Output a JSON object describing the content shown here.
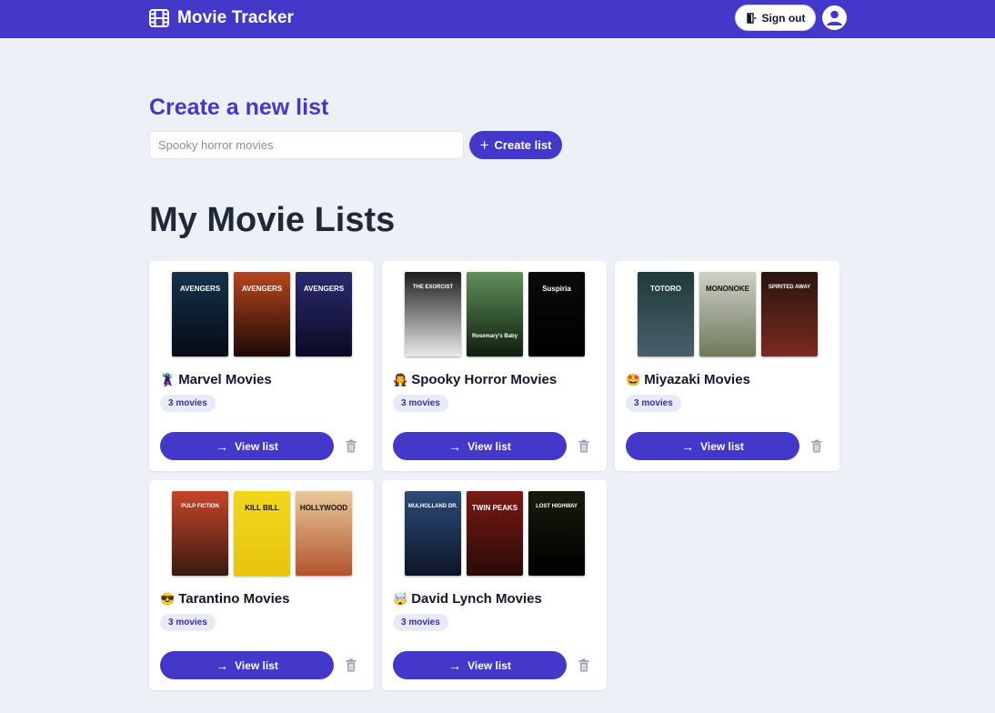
{
  "header": {
    "app_name": "Movie Tracker",
    "signout_label": "Sign out"
  },
  "create": {
    "title": "Create a new list",
    "input_value": "",
    "input_placeholder": "Spooky horror movies",
    "button_label": "Create list"
  },
  "lists_title": "My Movie Lists",
  "view_label": "View list",
  "lists": [
    {
      "emoji": "🦹",
      "name": "Marvel Movies",
      "count": "3 movies",
      "posters": [
        {
          "title": "AVENGERS",
          "colors": [
            "#16324a",
            "#050b14"
          ]
        },
        {
          "title": "AVENGERS",
          "colors": [
            "#b8451c",
            "#1d0a06"
          ]
        },
        {
          "title": "AVENGERS",
          "colors": [
            "#2b2a6f",
            "#0a0a24"
          ]
        }
      ]
    },
    {
      "emoji": "🧛",
      "name": "Spooky Horror Movies",
      "count": "3 movies",
      "posters": [
        {
          "title": "THE EXORCIST",
          "colors": [
            "#1c1c1c",
            "#e9e9e9"
          ]
        },
        {
          "title": "Rosemary's Baby",
          "colors": [
            "#5f8f5a",
            "#0f1f0f"
          ]
        },
        {
          "title": "Suspiria",
          "colors": [
            "#0a0a0a",
            "#000000"
          ]
        }
      ]
    },
    {
      "emoji": "🤩",
      "name": "Miyazaki Movies",
      "count": "3 movies",
      "posters": [
        {
          "title": "TOTORO",
          "colors": [
            "#1f3a3a",
            "#4a5f6a"
          ]
        },
        {
          "title": "MONONOKE",
          "colors": [
            "#cfcfc7",
            "#6e7a5a"
          ]
        },
        {
          "title": "SPIRITED AWAY",
          "colors": [
            "#2a1410",
            "#7a2a1e"
          ]
        }
      ]
    },
    {
      "emoji": "😎",
      "name": "Tarantino Movies",
      "count": "3 movies",
      "posters": [
        {
          "title": "PULP FICTION",
          "colors": [
            "#c8442a",
            "#3a1a10"
          ]
        },
        {
          "title": "KILL BILL",
          "colors": [
            "#f2d71e",
            "#e6c50c"
          ]
        },
        {
          "title": "HOLLYWOOD",
          "colors": [
            "#e8c89a",
            "#b4542e"
          ]
        }
      ]
    },
    {
      "emoji": "🤯",
      "name": "David Lynch Movies",
      "count": "3 movies",
      "posters": [
        {
          "title": "MULHOLLAND DR.",
          "colors": [
            "#2c4a7a",
            "#0d1526"
          ]
        },
        {
          "title": "TWIN PEAKS",
          "colors": [
            "#7a1a14",
            "#2a0a08"
          ]
        },
        {
          "title": "LOST HIGHWAY",
          "colors": [
            "#1a1a10",
            "#000000"
          ]
        }
      ]
    }
  ],
  "colors": {
    "accent": "#4338ca",
    "background": "#edf0f6",
    "badge_bg": "#e8eaf6"
  },
  "icons": {
    "logo": "film-icon",
    "signout": "door-icon",
    "avatar": "user-icon",
    "create": "plus-icon",
    "view": "arrow-right-icon",
    "delete": "trash-icon"
  }
}
